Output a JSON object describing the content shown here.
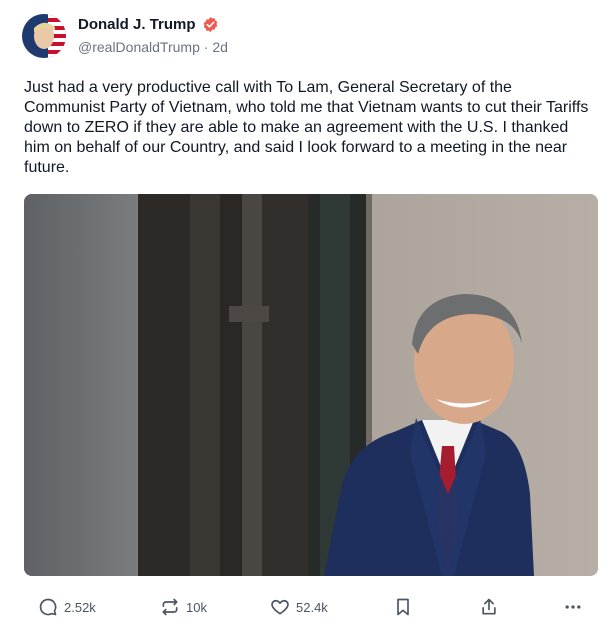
{
  "post": {
    "author_name": "Donald J. Trump",
    "verified_icon": "verified-badge-icon",
    "handle": "@realDonaldTrump",
    "separator": "·",
    "time_ago": "2d",
    "text": "Just had a very productive call with To Lam, General Secretary of the Communist Party of Vietnam, who told me that Vietnam wants to cut their Tariffs down to ZERO if they are able to make an agreement with the U.S. I thanked him on behalf of our Country, and said I look forward to a meeting in the near future.",
    "image_icon": "photo-of-man-in-suit"
  },
  "actions": {
    "replies": "2.52k",
    "reposts": "10k",
    "likes": "52.4k",
    "bookmark_icon": "bookmark-icon",
    "share_icon": "share-icon",
    "more_icon": "more-icon"
  },
  "colors": {
    "verified": "#ee5a52",
    "text": "#111827",
    "muted": "#6b7280"
  }
}
